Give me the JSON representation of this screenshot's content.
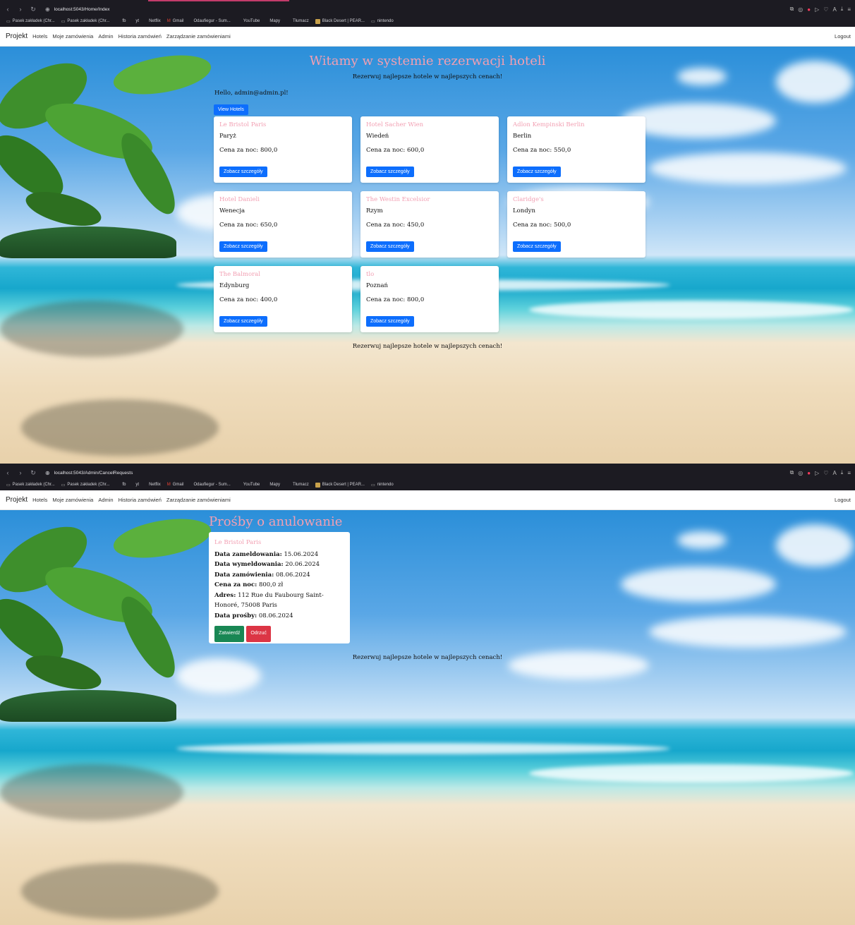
{
  "screen1": {
    "browser": {
      "url": "localhost:5043/Home/Index",
      "bookmarks": [
        "Pasek zakładek (Chr...",
        "Pasek zakładek (Chr...",
        "fb",
        "yt",
        "Netflix",
        "Gmail",
        "Odaufiegur - Sum...",
        "YouTube",
        "Mapy",
        "Tłumacz",
        "Black Desert | PEAR...",
        "nintendo"
      ]
    },
    "navbar": {
      "brand": "Projekt",
      "links": [
        "Hotels",
        "Moje zamówienia",
        "Admin",
        "Historia zamówień",
        "Zarządzanie zamówieniami"
      ],
      "logout": "Logout"
    },
    "title": "Witamy w systemie rezerwacji hoteli",
    "tagline": "Rezerwuj najlepsze hotele w najlepszych cenach!",
    "hello": "Hello, admin@admin.pl!",
    "view_hotels": "View Hotels",
    "hotels": [
      {
        "name": "Le Bristol Paris",
        "city": "Paryż",
        "price": "Cena za noc: 800,0",
        "button": "Zobacz szczegóły"
      },
      {
        "name": "Hotel Sacher Wien",
        "city": "Wiedeń",
        "price": "Cena za noc: 600,0",
        "button": "Zobacz szczegóły"
      },
      {
        "name": "Adlon Kempinski Berlin",
        "city": "Berlin",
        "price": "Cena za noc: 550,0",
        "button": "Zobacz szczegóły"
      },
      {
        "name": "Hotel Danieli",
        "city": "Wenecja",
        "price": "Cena za noc: 650,0",
        "button": "Zobacz szczegóły"
      },
      {
        "name": "The Westin Excelsior",
        "city": "Rzym",
        "price": "Cena za noc: 450,0",
        "button": "Zobacz szczegóły"
      },
      {
        "name": "Claridge's",
        "city": "Londyn",
        "price": "Cena za noc: 500,0",
        "button": "Zobacz szczegóły"
      },
      {
        "name": "The Balmoral",
        "city": "Edynburg",
        "price": "Cena za noc: 400,0",
        "button": "Zobacz szczegóły"
      },
      {
        "name": "tlo",
        "city": "Poznań",
        "price": "Cena za noc: 800,0",
        "button": "Zobacz szczegóły"
      }
    ],
    "footer": "Rezerwuj najlepsze hotele w najlepszych cenach!"
  },
  "screen2": {
    "browser": {
      "url": "localhost:5043/Admin/CancelRequests",
      "bookmarks": [
        "Pasek zakładek (Chr...",
        "Pasek zakładek (Chr...",
        "fb",
        "yt",
        "Netflix",
        "Gmail",
        "Odaufiegur - Sum...",
        "YouTube",
        "Mapy",
        "Tłumacz",
        "Black Desert | PEAR...",
        "nintendo"
      ]
    },
    "navbar": {
      "brand": "Projekt",
      "links": [
        "Hotels",
        "Moje zamówienia",
        "Admin",
        "Historia zamówień",
        "Zarządzanie zamówieniami"
      ],
      "logout": "Logout"
    },
    "title": "Prośby o anulowanie",
    "request": {
      "hotel": "Le Bristol Paris",
      "checkin_label": "Data zameldowania:",
      "checkin": "15.06.2024",
      "checkout_label": "Data wymeldowania:",
      "checkout": "20.06.2024",
      "order_label": "Data zamówienia:",
      "order": "08.06.2024",
      "price_label": "Cena za noc:",
      "price": "800,0 zł",
      "address_label": "Adres:",
      "address": "112 Rue du Faubourg Saint-Honoré, 75008 Paris",
      "request_label": "Data prośby:",
      "request_date": "08.06.2024",
      "approve": "Zatwierdź",
      "reject": "Odrzuć"
    },
    "footer": "Rezerwuj najlepsze hotele w najlepszych cenach!"
  },
  "colors": {
    "title_pink": "#f29fb2",
    "primary": "#0d6efd",
    "success": "#198754",
    "danger": "#dc3545",
    "chrome_dark": "#1c1b22"
  }
}
